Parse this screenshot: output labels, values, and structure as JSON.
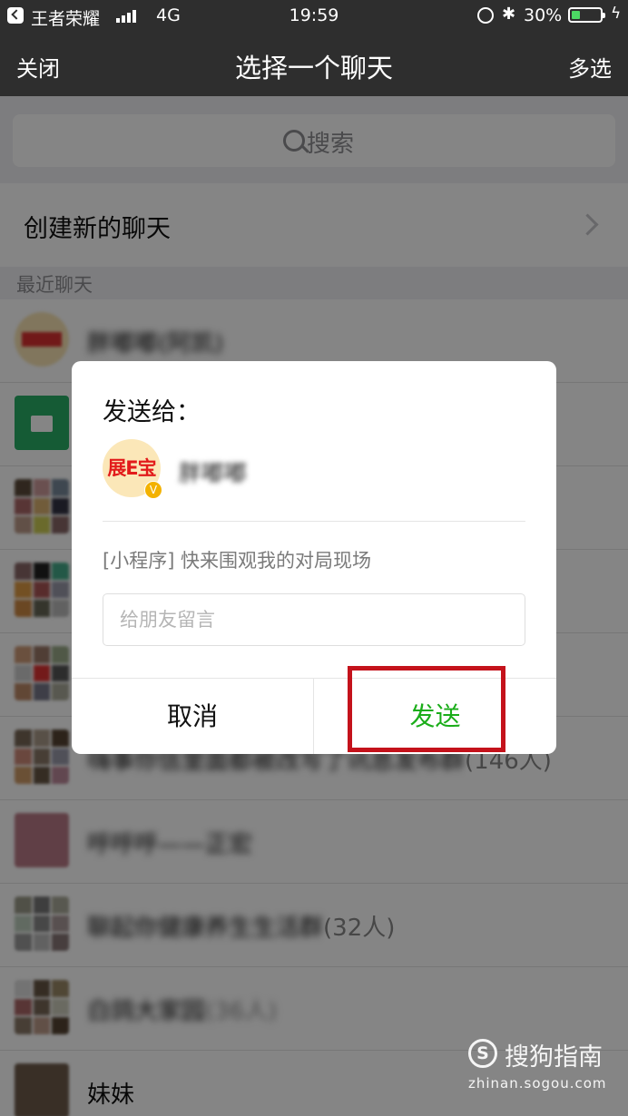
{
  "status_bar": {
    "carrier": "王者荣耀",
    "network": "4G",
    "time": "19:59",
    "battery_percent": "30%",
    "battery_level": 0.3,
    "bluetooth_icon": "bluetooth-icon",
    "charging_icon": "bolt-icon"
  },
  "nav": {
    "close_label": "关闭",
    "title": "选择一个聊天",
    "multi_select_label": "多选"
  },
  "search": {
    "label": "搜索"
  },
  "create_new_chat": {
    "label": "创建新的聊天"
  },
  "recent_header": "最近聊天",
  "chats": [
    {
      "name": "胖嘟嘟(阿凯)",
      "avatar": "brand-avatar"
    },
    {
      "name": "",
      "avatar": "green-file-transfer"
    },
    {
      "name": "",
      "avatar": "group-grid"
    },
    {
      "name": "",
      "avatar": "group-grid"
    },
    {
      "name": "",
      "avatar": "group-grid"
    },
    {
      "name": "嗨事你信里面都被改写了讯息发布群",
      "suffix": "(146人)",
      "avatar": "group-grid"
    },
    {
      "name": "呼呼呼——正宏",
      "avatar": "photo"
    },
    {
      "name": "聊起你健康养生生活群",
      "suffix": "(32人)",
      "avatar": "group-grid"
    },
    {
      "name": "白鸽大家园",
      "suffix": "(36人)",
      "avatar": "group-grid"
    },
    {
      "name": "妹妹",
      "avatar": "photo"
    }
  ],
  "dialog": {
    "send_to_label": "发送给：",
    "target_name": "胖嘟嘟",
    "target_avatar_text": "展E宝",
    "target_badge": "V",
    "mini_program_text": "[小程序] 快来围观我的对局现场",
    "message_placeholder": "给朋友留言",
    "cancel_label": "取消",
    "send_label": "发送"
  },
  "watermark": {
    "logo_letter": "S",
    "text": "搜狗指南",
    "url": "zhinan.sogou.com"
  },
  "colors": {
    "nav_bg": "#2e2e2e",
    "send_green": "#1aad19",
    "highlight_red": "#c4121b",
    "battery_green": "#4cd964"
  }
}
